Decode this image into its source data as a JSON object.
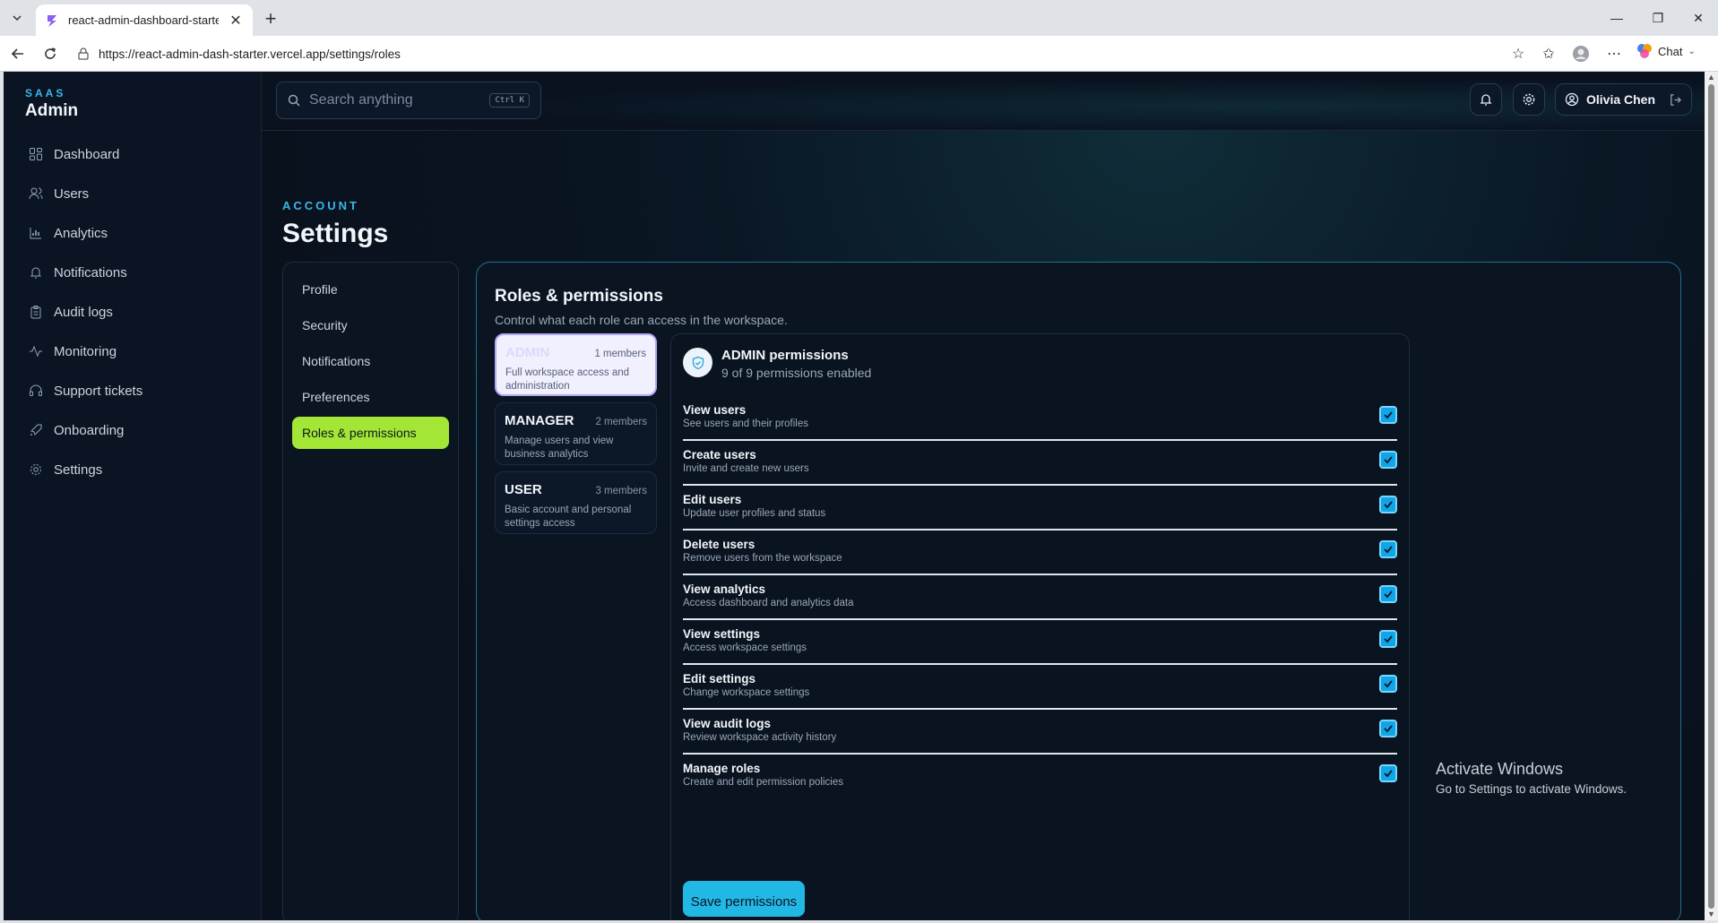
{
  "browser": {
    "tab_title": "react-admin-dashboard-starter-te",
    "url": "https://react-admin-dash-starter.vercel.app/settings/roles",
    "chat_label": "Chat"
  },
  "sidebar": {
    "brand_small": "SAAS",
    "brand_big": "Admin",
    "items": [
      {
        "label": "Dashboard",
        "icon": "grid-icon"
      },
      {
        "label": "Users",
        "icon": "users-icon"
      },
      {
        "label": "Analytics",
        "icon": "bar-chart-icon"
      },
      {
        "label": "Notifications",
        "icon": "bell-icon"
      },
      {
        "label": "Audit logs",
        "icon": "clipboard-icon"
      },
      {
        "label": "Monitoring",
        "icon": "activity-icon"
      },
      {
        "label": "Support tickets",
        "icon": "headset-icon"
      },
      {
        "label": "Onboarding",
        "icon": "rocket-icon"
      },
      {
        "label": "Settings",
        "icon": "gear-icon"
      }
    ]
  },
  "topbar": {
    "search_placeholder": "Search anything",
    "shortcut": "Ctrl K",
    "user_name": "Olivia Chen"
  },
  "page": {
    "eyebrow": "ACCOUNT",
    "title": "Settings"
  },
  "settings_nav": {
    "items": [
      "Profile",
      "Security",
      "Notifications",
      "Preferences",
      "Roles & permissions"
    ],
    "active": "Roles & permissions"
  },
  "roles": {
    "title": "Roles & permissions",
    "subtitle": "Control what each role can access in the workspace.",
    "list": [
      {
        "name": "ADMIN",
        "members": "1 members",
        "desc": "Full workspace access and administration"
      },
      {
        "name": "MANAGER",
        "members": "2 members",
        "desc": "Manage users and view business analytics"
      },
      {
        "name": "USER",
        "members": "3 members",
        "desc": "Basic account and personal settings access"
      }
    ],
    "selected": "ADMIN"
  },
  "permissions": {
    "title": "ADMIN permissions",
    "count_text": "9 of 9 permissions enabled",
    "items": [
      {
        "name": "View users",
        "desc": "See users and their profiles",
        "enabled": true
      },
      {
        "name": "Create users",
        "desc": "Invite and create new users",
        "enabled": true
      },
      {
        "name": "Edit users",
        "desc": "Update user profiles and status",
        "enabled": true
      },
      {
        "name": "Delete users",
        "desc": "Remove users from the workspace",
        "enabled": true
      },
      {
        "name": "View analytics",
        "desc": "Access dashboard and analytics data",
        "enabled": true
      },
      {
        "name": "View settings",
        "desc": "Access workspace settings",
        "enabled": true
      },
      {
        "name": "Edit settings",
        "desc": "Change workspace settings",
        "enabled": true
      },
      {
        "name": "View audit logs",
        "desc": "Review workspace activity history",
        "enabled": true
      },
      {
        "name": "Manage roles",
        "desc": "Create and edit permission policies",
        "enabled": true
      }
    ],
    "save_label": "Save permissions"
  },
  "watermark": {
    "title": "Activate Windows",
    "subtitle": "Go to Settings to activate Windows."
  },
  "colors": {
    "accent": "#3ab7ea",
    "active_nav": "#a3e635",
    "checkbox": "#0ea5e9",
    "background": "#0a1220"
  }
}
